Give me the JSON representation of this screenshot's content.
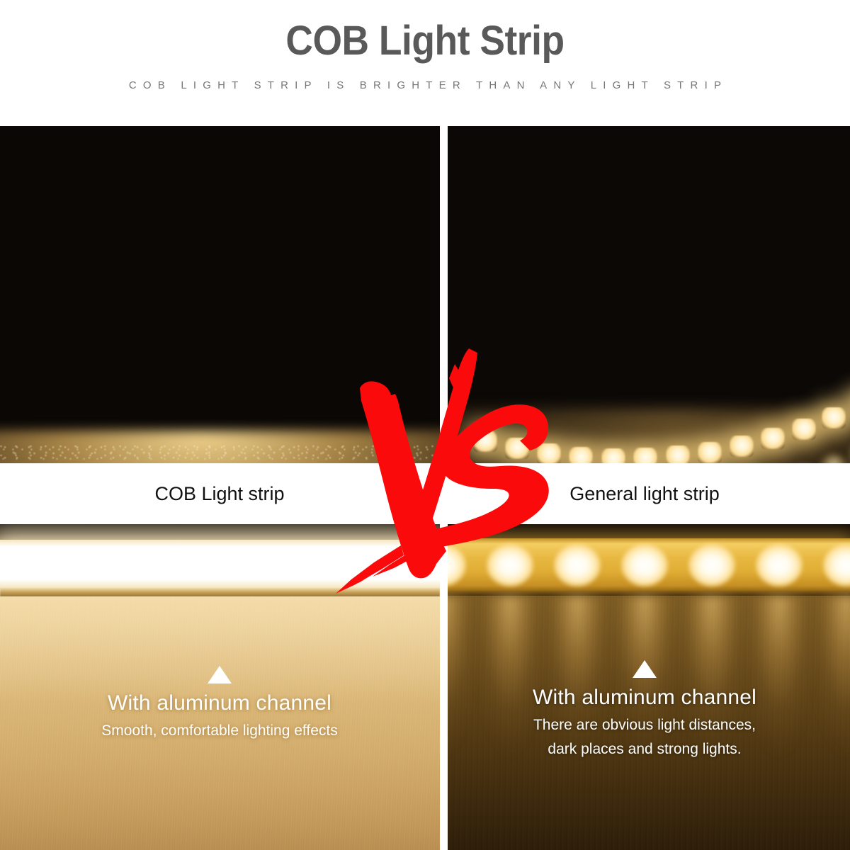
{
  "header": {
    "title": "COB Light Strip",
    "subtitle": "COB LIGHT STRIP IS BRIGHTER THAN ANY LIGHT STRIP",
    "title_color": "#595959",
    "subtitle_color": "#777777"
  },
  "comparison": {
    "vs_label": "VS",
    "vs_color": "#FA0A0A",
    "left": {
      "strip_label": "COB Light strip",
      "caption_heading": "With aluminum channel",
      "caption_lines": [
        "Smooth, comfortable lighting effects"
      ],
      "marker_icon": "triangle-up-icon"
    },
    "right": {
      "strip_label": "General light strip",
      "caption_heading": "With aluminum channel",
      "caption_lines": [
        "There are obvious light distances,",
        "dark places and strong lights."
      ],
      "marker_icon": "triangle-up-icon"
    }
  },
  "photos": {
    "top_left": "cob-strip-reel-continuous-photo",
    "top_right": "smd-strip-reel-dotted-photo",
    "bottom_left": "aluminum-channel-even-light-photo",
    "bottom_right": "aluminum-channel-spotty-light-photo"
  }
}
